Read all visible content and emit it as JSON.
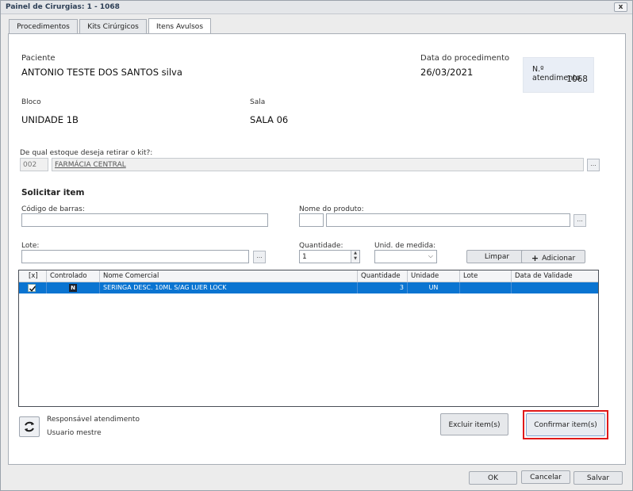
{
  "window": {
    "title": "Painel de Cirurgias: 1 - 1068",
    "close_label": "x"
  },
  "tabs": [
    {
      "label": "Procedimentos"
    },
    {
      "label": "Kits Cirúrgicos"
    },
    {
      "label": "Itens Avulsos"
    }
  ],
  "patient": {
    "label": "Paciente",
    "value": "ANTONIO TESTE DOS SANTOS silva",
    "date_label": "Data do procedimento",
    "date_value": "26/03/2021",
    "atendimento_label": "N.º atendimento",
    "atendimento_value": "1068",
    "bloco_label": "Bloco",
    "bloco_value": "UNIDADE 1B",
    "sala_label": "Sala",
    "sala_value": "SALA 06"
  },
  "estoque": {
    "label": "De qual estoque deseja retirar o kit?:",
    "code": "002",
    "name": "FARMÁCIA CENTRAL",
    "dots": "..."
  },
  "solicitar": {
    "title": "Solicitar item",
    "barcode_label": "Código de barras:",
    "barcode_value": "",
    "produto_label": "Nome do produto:",
    "produto_code": "",
    "produto_name": "",
    "lote_label": "Lote:",
    "lote_value": "",
    "quantidade_label": "Quantidade:",
    "quantidade_value": "1",
    "unid_label": "Unid. de medida:",
    "unid_value": "",
    "limpar_label": "Limpar",
    "adicionar_label": "Adicionar",
    "dots": "..."
  },
  "grid": {
    "headers": [
      "[x]",
      "Controlado",
      "Nome Comercial",
      "Quantidade",
      "Unidade",
      "Lote",
      "Data de Validade"
    ],
    "rows": [
      {
        "checked": true,
        "controlado": "N",
        "nome": "SERINGA DESC. 10ML S/AG LUER LOCK",
        "quantidade": "3",
        "unidade": "UN",
        "lote": "",
        "validade": ""
      }
    ]
  },
  "responsavel": {
    "label": "Responsável atendimento",
    "value": "Usuario mestre"
  },
  "actions": {
    "excluir": "Excluir item(s)",
    "confirmar": "Confirmar item(s)"
  },
  "footer": {
    "ok": "OK",
    "cancelar": "Cancelar",
    "salvar": "Salvar"
  },
  "colors": {
    "accent": "#0a74d1",
    "highlight": "#e01919"
  }
}
